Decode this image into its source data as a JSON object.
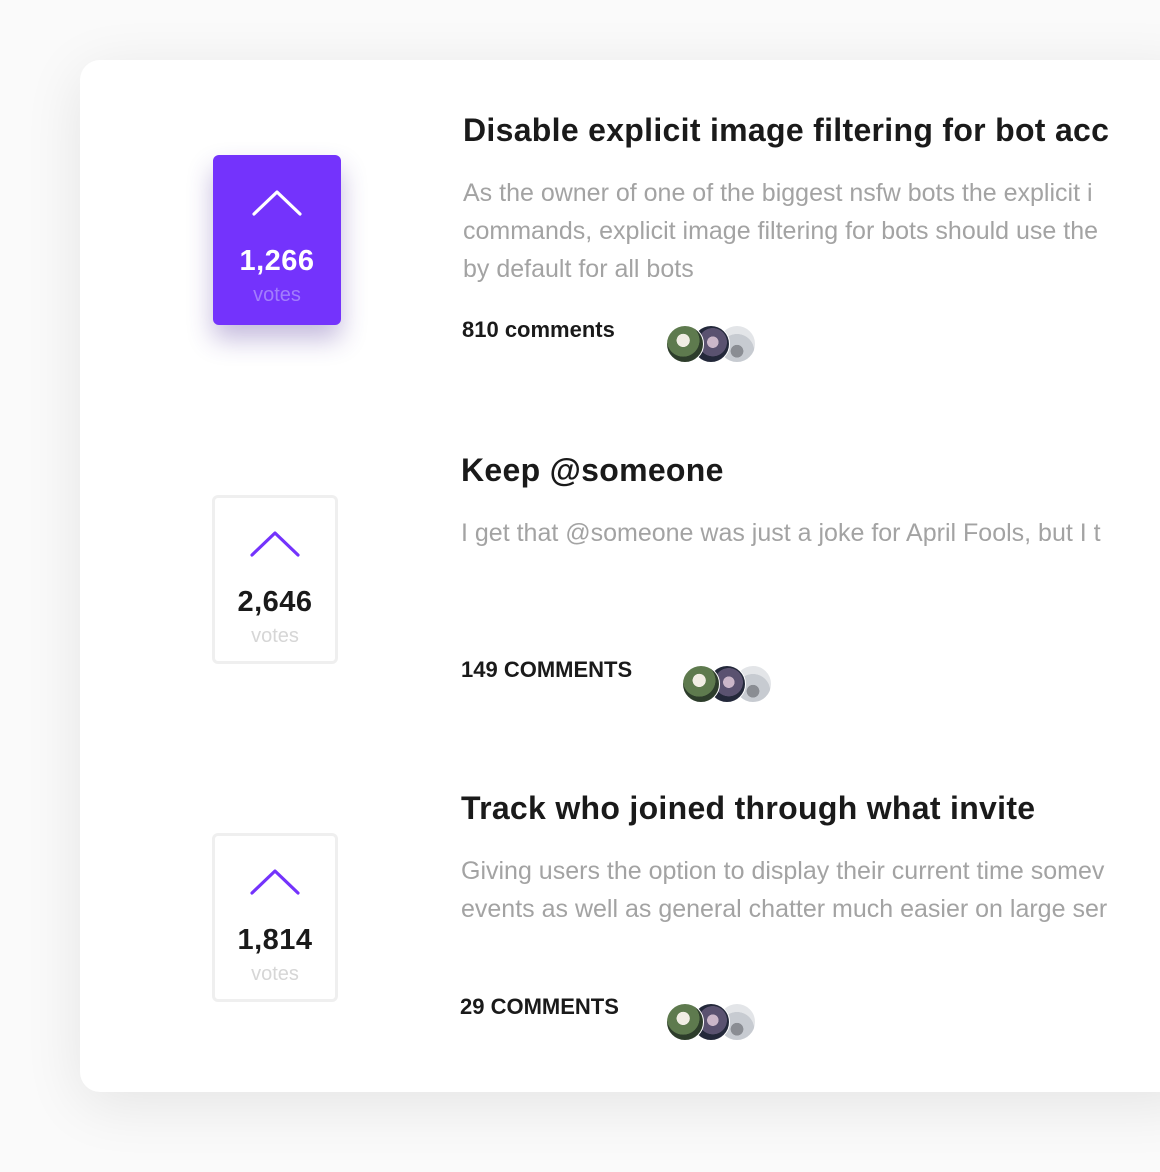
{
  "posts": [
    {
      "title": "Disable explicit image filtering for bot acc",
      "description": "As the owner of one of the biggest nsfw bots the explicit i\ncommands, explicit image filtering for bots should use the\nby default for all bots",
      "votes": "1,266",
      "votes_label": "votes",
      "comments": "810 comments",
      "upvoted": true
    },
    {
      "title": "Keep @someone",
      "description": "I get that @someone was just a joke for April Fools, but I t",
      "votes": "2,646",
      "votes_label": "votes",
      "comments": "149 COMMENTS",
      "upvoted": false
    },
    {
      "title": "Track who joined through what invite",
      "description": "Giving users the option to display their current time somev\nevents as well as general chatter much easier on large ser",
      "votes": "1,814",
      "votes_label": "votes",
      "comments": "29 COMMENTS",
      "upvoted": false
    }
  ],
  "colors": {
    "accent": "#7433fc",
    "background": "#fafafa",
    "card": "#ffffff",
    "title_text": "#1a1a1a",
    "description_text": "#a3a3a3"
  },
  "icons": {
    "upvote": "chevron-up-icon",
    "avatar_group": "commenter-avatars"
  }
}
